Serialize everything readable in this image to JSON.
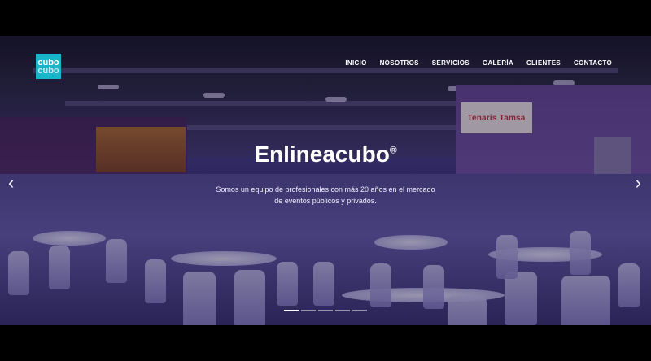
{
  "brand": {
    "logo_top": "cubo",
    "logo_bottom": "cubo"
  },
  "nav": {
    "items": [
      "INICIO",
      "NOSOTROS",
      "SERVICIOS",
      "GALERÍA",
      "CLIENTES",
      "CONTACTO"
    ]
  },
  "hero": {
    "title": "Enlineacubo",
    "title_mark": "®",
    "subtitle": "Somos un equipo de profesionales con más 20 años en el mercado de eventos públicos y privados.",
    "banner_text": "Tenaris Tamsa"
  },
  "controls": {
    "prev": "‹",
    "next": "›"
  },
  "carousel": {
    "slides": 5,
    "active": 1
  },
  "colors": {
    "accent": "#19b6c9"
  }
}
